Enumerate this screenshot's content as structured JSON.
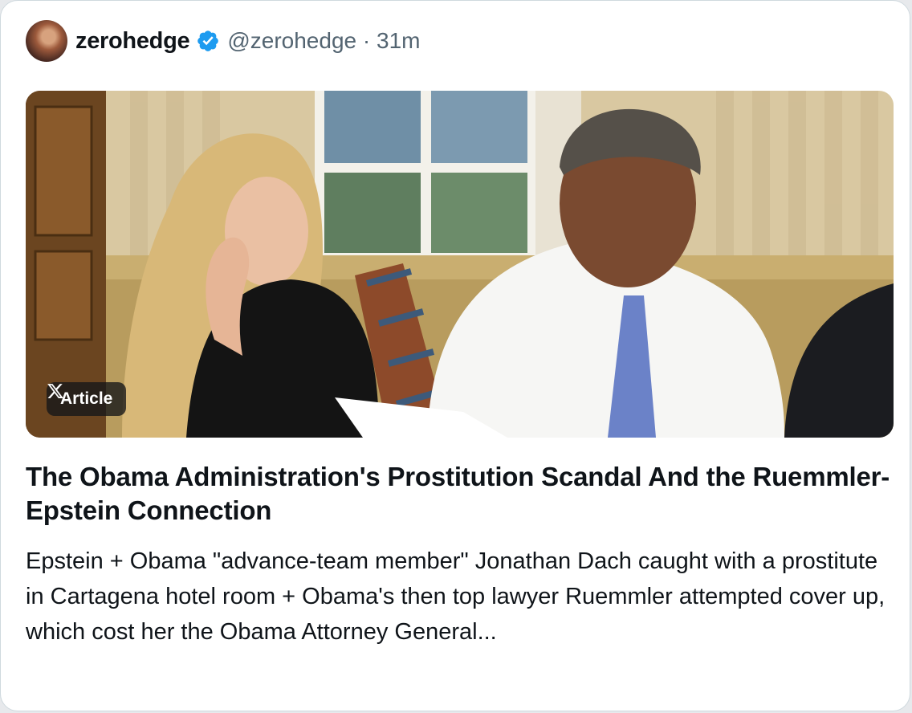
{
  "post": {
    "display_name": "zerohedge",
    "handle": "@zerohedge",
    "separator": "·",
    "time": "31m",
    "verified_color": "#1d9bf0"
  },
  "article": {
    "badge_label": "Article",
    "badge_icon": "x-logo-icon",
    "title": "The Obama Administration's Prostitution Scandal And the Ruemmler-Epstein Connection",
    "description": "Epstein + Obama \"advance-team member\" Jonathan Dach caught with a prostitute in Cartagena hotel room + Obama's then top lawyer Ruemmler attempted cover up, which cost her the Obama Attorney General..."
  }
}
